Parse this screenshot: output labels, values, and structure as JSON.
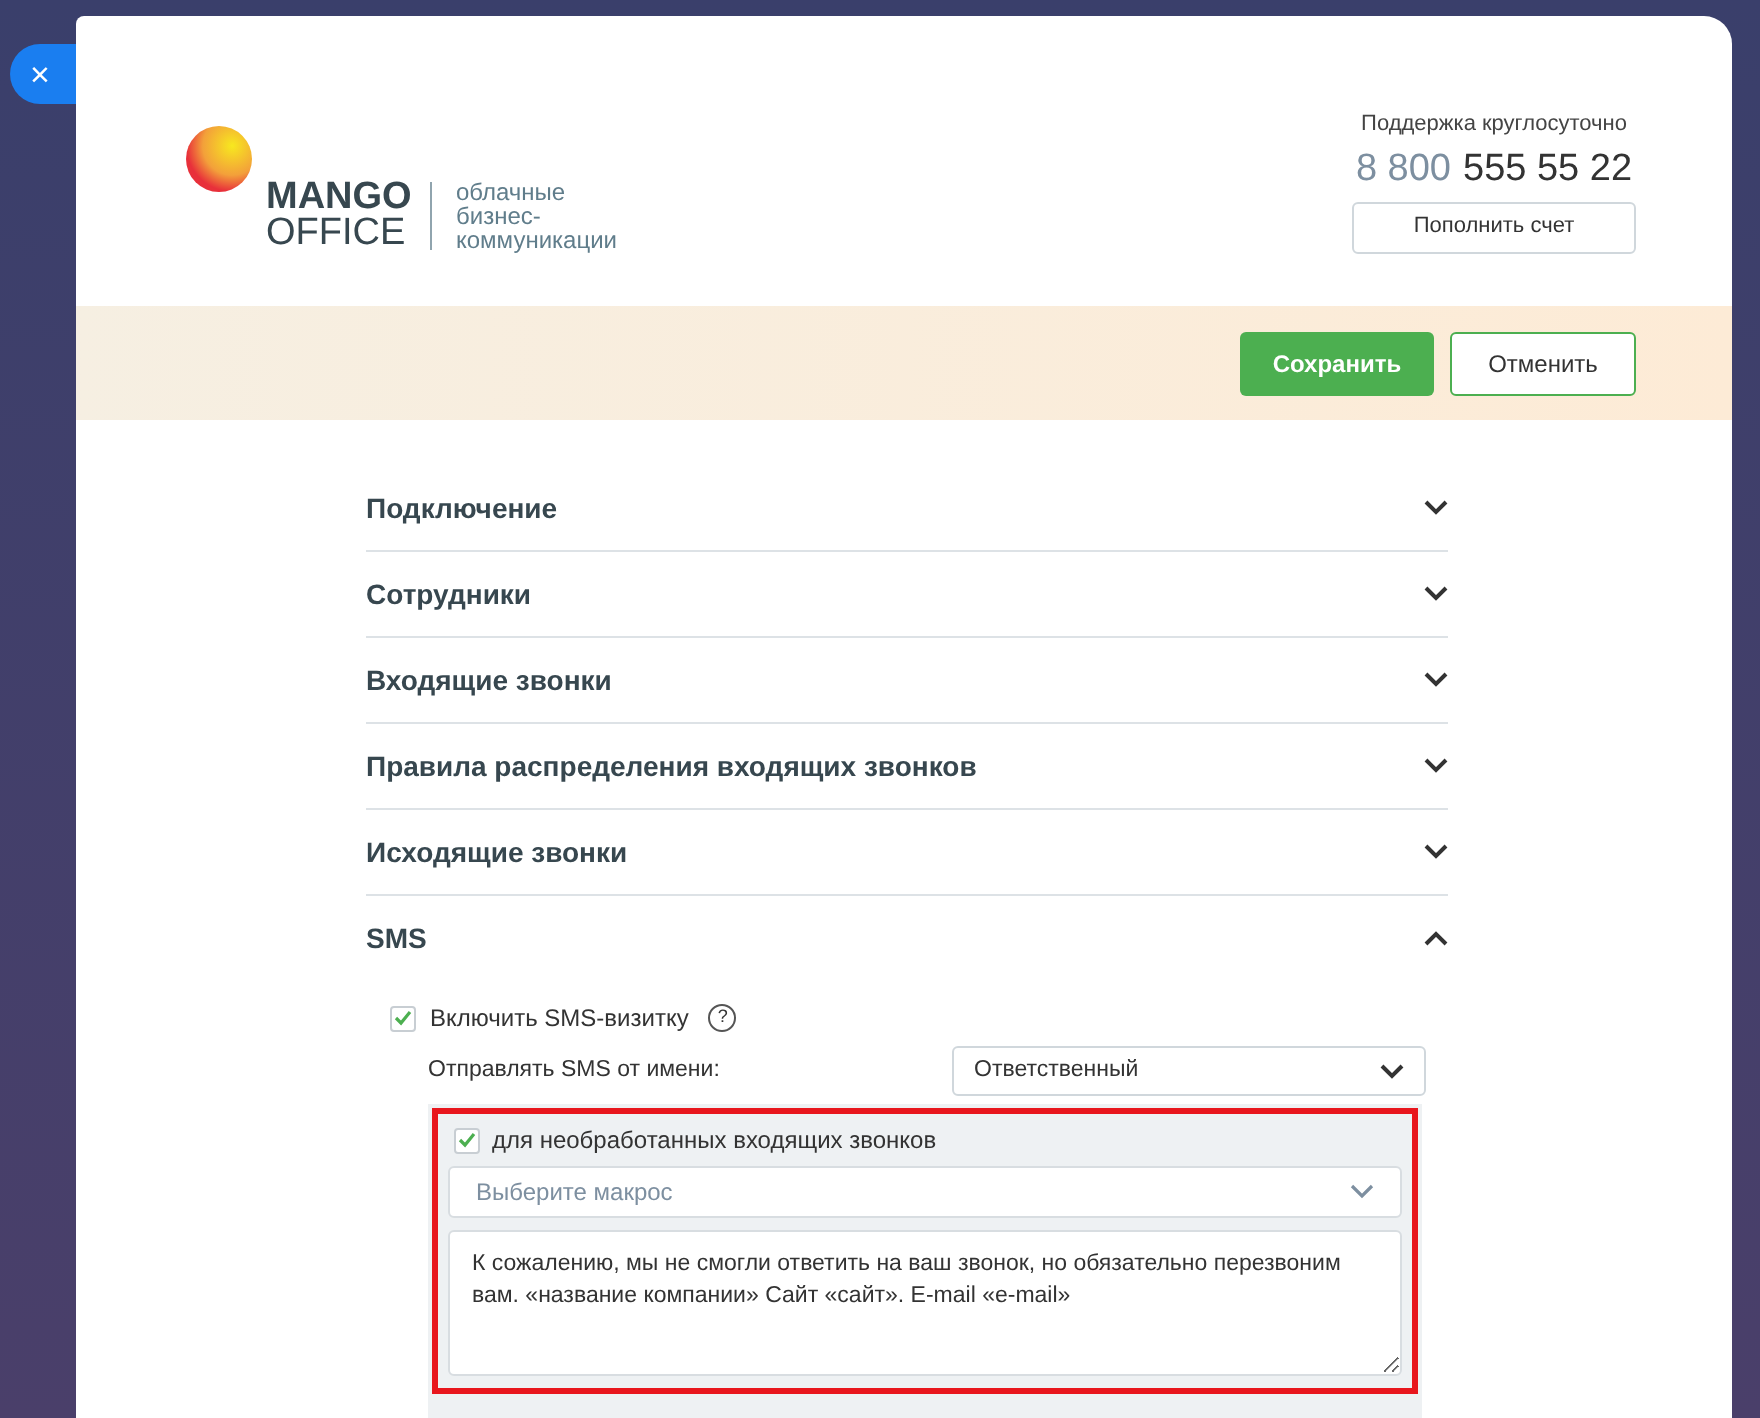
{
  "close_button": {
    "label": "×"
  },
  "header": {
    "logo": {
      "word1": "MANGO",
      "word2": "OFFICE",
      "tagline": [
        "облачные",
        "бизнес-",
        "коммуникации"
      ]
    },
    "support": {
      "label": "Поддержка круглосуточно",
      "phone_prefix": "8 800",
      "phone_number": "555 55 22",
      "button": "Пополнить счет"
    }
  },
  "actions": [
    {
      "label": "Сохранить",
      "kind": "primary"
    },
    {
      "label": "Отменить",
      "kind": "secondary"
    }
  ],
  "sections": [
    {
      "title": "Подключение",
      "expanded": false
    },
    {
      "title": "Сотрудники",
      "expanded": false
    },
    {
      "title": "Входящие звонки",
      "expanded": false
    },
    {
      "title": "Правила распределения входящих звонков",
      "expanded": false
    },
    {
      "title": "Исходящие звонки",
      "expanded": false
    },
    {
      "title": "SMS",
      "expanded": true
    }
  ],
  "sms": {
    "enable": {
      "label": "Включить SMS-визитку",
      "checked": true,
      "help": "?"
    },
    "sender": {
      "label": "Отправлять SMS от имени:",
      "value": "Ответственный"
    },
    "missed": {
      "label": "для необработанных входящих звонков",
      "checked": true,
      "highlighted": true,
      "macro": {
        "placeholder": "Выберите макрос"
      },
      "message": "К сожалению, мы не смогли ответить на ваш звонок, но обязательно перезвоним вам. «название компании» Сайт «сайт». E-mail «e-mail»"
    }
  }
}
